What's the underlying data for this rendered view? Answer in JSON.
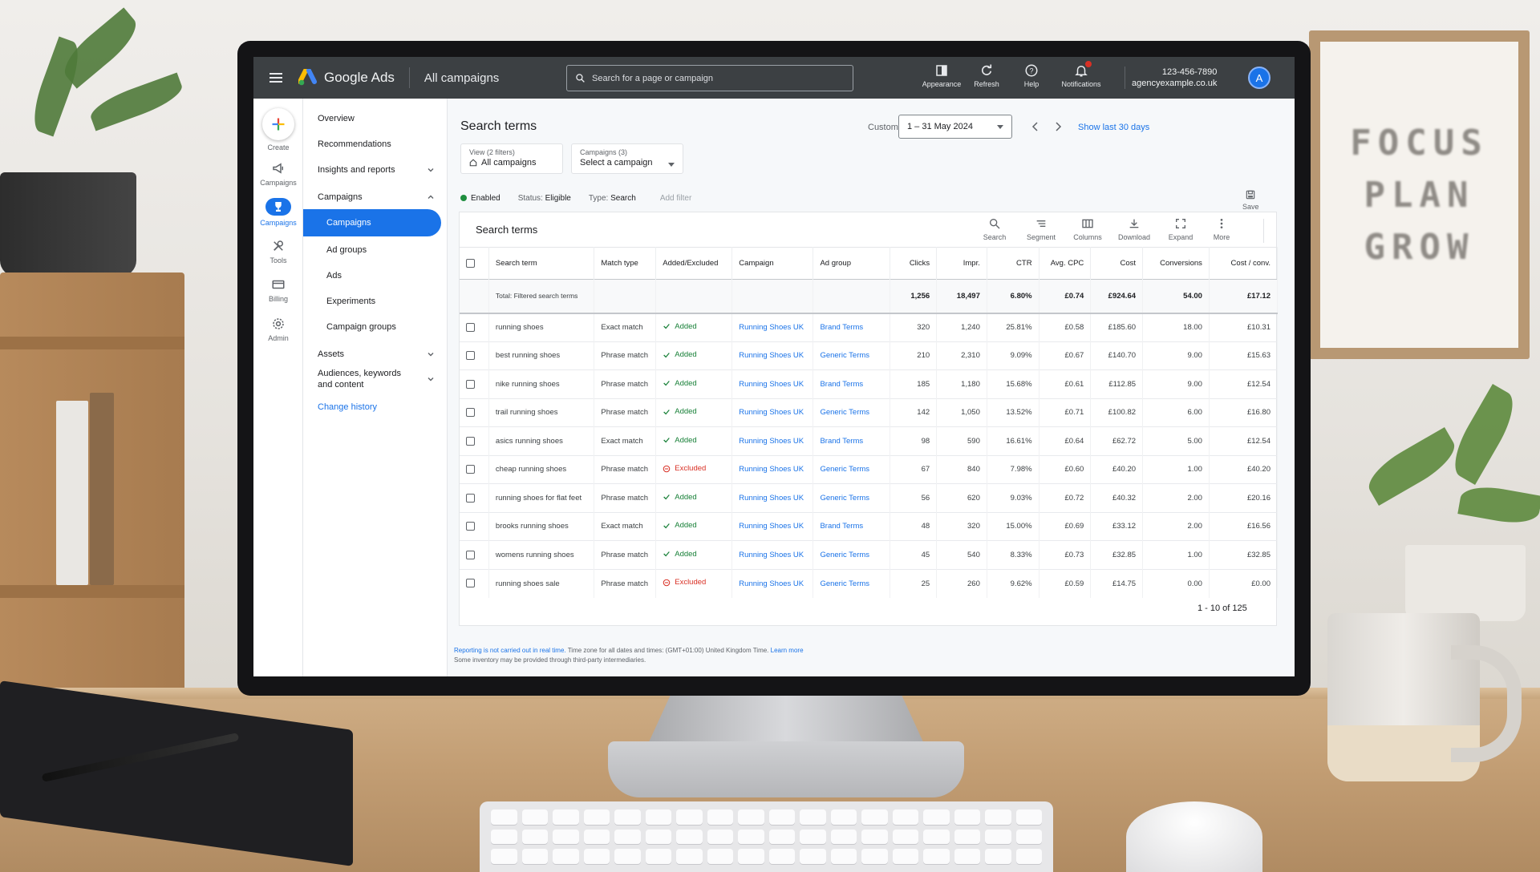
{
  "topbar": {
    "app_title": "Google Ads",
    "breadcrumb": "All campaigns",
    "search_placeholder": "Search for a page or campaign",
    "actions": [
      {
        "label": "Appearance",
        "icon": "appearance-icon"
      },
      {
        "label": "Refresh",
        "icon": "refresh-icon"
      },
      {
        "label": "Help",
        "icon": "help-icon"
      },
      {
        "label": "Notifications",
        "icon": "bell-icon",
        "badge": "1"
      }
    ],
    "account_phone": "123-456-7890",
    "account_domain": "agencyexample.co.uk",
    "avatar_letter": "A"
  },
  "rail": [
    {
      "label": "Create",
      "icon": "plus-icon"
    },
    {
      "label": "Campaigns",
      "icon": "megaphone-icon"
    },
    {
      "label": "Campaigns",
      "icon": "trophy-icon",
      "active": true
    },
    {
      "label": "Tools",
      "icon": "tools-icon"
    },
    {
      "label": "Billing",
      "icon": "card-icon"
    },
    {
      "label": "Admin",
      "icon": "gear-icon"
    }
  ],
  "sidenav": {
    "overview": "Overview",
    "recommendations": "Recommendations",
    "insights": "Insights and reports",
    "campaigns_group": "Campaigns",
    "campaigns": "Campaigns",
    "ad_groups": "Ad groups",
    "ads": "Ads",
    "experiments": "Experiments",
    "campaign_groups": "Campaign groups",
    "assets": "Assets",
    "audiences_line1": "Audiences, keywords",
    "audiences_line2": "and content",
    "change_history": "Change history"
  },
  "page": {
    "title": "Search terms",
    "date_label": "Custom",
    "date_range": "1 – 31 May 2024",
    "show_last": "Show last 30 days",
    "view_filter_label": "View (2 filters)",
    "view_filter_value": "All campaigns",
    "campaigns_filter_label": "Campaigns (3)",
    "campaigns_filter_value": "Select a campaign",
    "chip_enabled": "Enabled",
    "chip_status_label": "Status:",
    "chip_status_value": "Eligible",
    "chip_type_label": "Type:",
    "chip_type_value": "Search",
    "add_filter": "Add filter",
    "save": "Save"
  },
  "table": {
    "title": "Search terms",
    "tools": [
      {
        "label": "Search",
        "icon": "search-icon"
      },
      {
        "label": "Segment",
        "icon": "segment-icon"
      },
      {
        "label": "Columns",
        "icon": "columns-icon"
      },
      {
        "label": "Download",
        "icon": "download-icon"
      },
      {
        "label": "Expand",
        "icon": "expand-icon"
      },
      {
        "label": "More",
        "icon": "more-vert-icon"
      }
    ],
    "headers": [
      "Search term",
      "Match type",
      "Added/Excluded",
      "Campaign",
      "Ad group",
      "Clicks",
      "Impr.",
      "CTR",
      "Avg. CPC",
      "Cost",
      "Conversions",
      "Cost / conv."
    ],
    "total": {
      "label": "Total: Filtered search terms",
      "clicks": "1,256",
      "impr": "18,497",
      "ctr": "6.80%",
      "cpc": "£0.74",
      "cost": "£924.64",
      "conv": "54.00",
      "cost_conv": "£17.12"
    },
    "rows": [
      {
        "term": "running shoes",
        "match": "Exact match",
        "status": "Added",
        "campaign": "Running Shoes UK",
        "adgroup": "Brand Terms",
        "clicks": "320",
        "impr": "1,240",
        "ctr": "25.81%",
        "cpc": "£0.58",
        "cost": "£185.60",
        "conv": "18.00",
        "cost_conv": "£10.31"
      },
      {
        "term": "best running shoes",
        "match": "Phrase match",
        "status": "Added",
        "campaign": "Running Shoes UK",
        "adgroup": "Generic Terms",
        "clicks": "210",
        "impr": "2,310",
        "ctr": "9.09%",
        "cpc": "£0.67",
        "cost": "£140.70",
        "conv": "9.00",
        "cost_conv": "£15.63"
      },
      {
        "term": "nike running shoes",
        "match": "Phrase match",
        "status": "Added",
        "campaign": "Running Shoes UK",
        "adgroup": "Brand Terms",
        "clicks": "185",
        "impr": "1,180",
        "ctr": "15.68%",
        "cpc": "£0.61",
        "cost": "£112.85",
        "conv": "9.00",
        "cost_conv": "£12.54"
      },
      {
        "term": "trail running shoes",
        "match": "Phrase match",
        "status": "Added",
        "campaign": "Running Shoes UK",
        "adgroup": "Generic Terms",
        "clicks": "142",
        "impr": "1,050",
        "ctr": "13.52%",
        "cpc": "£0.71",
        "cost": "£100.82",
        "conv": "6.00",
        "cost_conv": "£16.80"
      },
      {
        "term": "asics running shoes",
        "match": "Exact match",
        "status": "Added",
        "campaign": "Running Shoes UK",
        "adgroup": "Brand Terms",
        "clicks": "98",
        "impr": "590",
        "ctr": "16.61%",
        "cpc": "£0.64",
        "cost": "£62.72",
        "conv": "5.00",
        "cost_conv": "£12.54"
      },
      {
        "term": "cheap running shoes",
        "match": "Phrase match",
        "status": "Excluded",
        "campaign": "Running Shoes UK",
        "adgroup": "Generic Terms",
        "clicks": "67",
        "impr": "840",
        "ctr": "7.98%",
        "cpc": "£0.60",
        "cost": "£40.20",
        "conv": "1.00",
        "cost_conv": "£40.20"
      },
      {
        "term": "running shoes for flat feet",
        "match": "Phrase match",
        "status": "Added",
        "campaign": "Running Shoes UK",
        "adgroup": "Generic Terms",
        "clicks": "56",
        "impr": "620",
        "ctr": "9.03%",
        "cpc": "£0.72",
        "cost": "£40.32",
        "conv": "2.00",
        "cost_conv": "£20.16"
      },
      {
        "term": "brooks running shoes",
        "match": "Exact match",
        "status": "Added",
        "campaign": "Running Shoes UK",
        "adgroup": "Brand Terms",
        "clicks": "48",
        "impr": "320",
        "ctr": "15.00%",
        "cpc": "£0.69",
        "cost": "£33.12",
        "conv": "2.00",
        "cost_conv": "£16.56"
      },
      {
        "term": "womens running shoes",
        "match": "Phrase match",
        "status": "Added",
        "campaign": "Running Shoes UK",
        "adgroup": "Generic Terms",
        "clicks": "45",
        "impr": "540",
        "ctr": "8.33%",
        "cpc": "£0.73",
        "cost": "£32.85",
        "conv": "1.00",
        "cost_conv": "£32.85"
      },
      {
        "term": "running shoes sale",
        "match": "Phrase match",
        "status": "Excluded",
        "campaign": "Running Shoes UK",
        "adgroup": "Generic Terms",
        "clicks": "25",
        "impr": "260",
        "ctr": "9.62%",
        "cpc": "£0.59",
        "cost": "£14.75",
        "conv": "0.00",
        "cost_conv": "£0.00"
      }
    ],
    "pagination": "1 - 10 of 125"
  },
  "footnote": {
    "link1": "Reporting is not carried out in real time.",
    "text1": " Time zone for all dates and times: (GMT+01:00) United Kingdom Time. ",
    "link2": "Learn more",
    "line2": "Some inventory may be provided through third-party intermediaries."
  },
  "poster_words": [
    "FOCUS",
    "PLAN",
    "GROW"
  ],
  "colors": {
    "accent": "#1a73e8",
    "topbar": "#3c4043",
    "added": "#188038",
    "excluded": "#d93025"
  }
}
